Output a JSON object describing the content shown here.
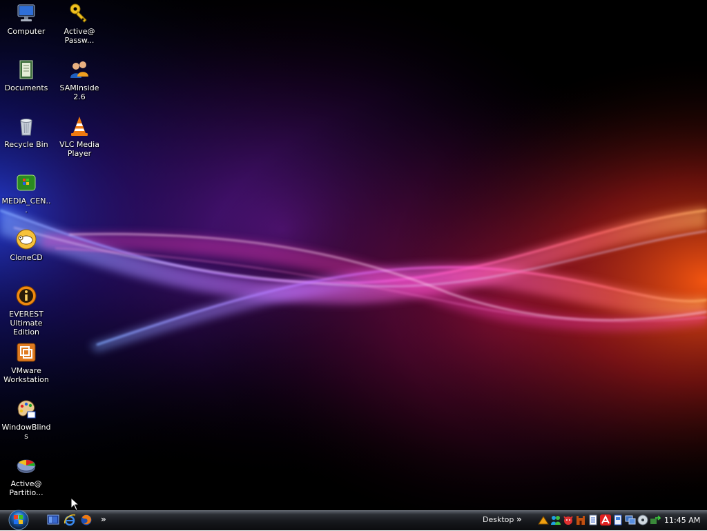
{
  "desktop": {
    "icons": [
      {
        "label": "Computer",
        "icon": "computer-icon"
      },
      {
        "label": "Active@ Passw...",
        "icon": "key-icon"
      },
      {
        "label": "Documents",
        "icon": "documents-icon"
      },
      {
        "label": "SAMInside 2.6",
        "icon": "users-icon"
      },
      {
        "label": "Recycle Bin",
        "icon": "recycle-bin-icon"
      },
      {
        "label": "VLC Media Player",
        "icon": "vlc-cone-icon"
      },
      {
        "label": "MEDIA_CEN...",
        "icon": "media-center-icon"
      },
      {
        "label": "CloneCD",
        "icon": "sheep-icon"
      },
      {
        "label": "EVEREST Ultimate Edition",
        "icon": "info-icon"
      },
      {
        "label": "VMware Workstation",
        "icon": "vmware-icon"
      },
      {
        "label": "WindowBlinds",
        "icon": "palette-icon"
      },
      {
        "label": "Active@ Partitio...",
        "icon": "partition-pie-icon"
      }
    ]
  },
  "taskbar": {
    "start_icon": "windows-start-orb-icon",
    "quick_launch": [
      "show-desktop-icon",
      "internet-explorer-icon",
      "firefox-icon"
    ],
    "quick_launch_more": "»",
    "desktop_toolbar_label": "Desktop",
    "desktop_toolbar_more": "»",
    "tray_icons": [
      "network-icon",
      "messenger-icon",
      "antivirus-icon",
      "castle-icon",
      "notepad-icon",
      "avira-icon",
      "document-icon",
      "computer-tray-icon",
      "disc-icon",
      "transfer-icon"
    ],
    "clock": "11:45 AM"
  },
  "colors": {
    "taskbar": "#16181c",
    "wave_blue": "#3a6bff",
    "wave_pink": "#ff3ab8",
    "wave_orange": "#ff7a1a"
  }
}
